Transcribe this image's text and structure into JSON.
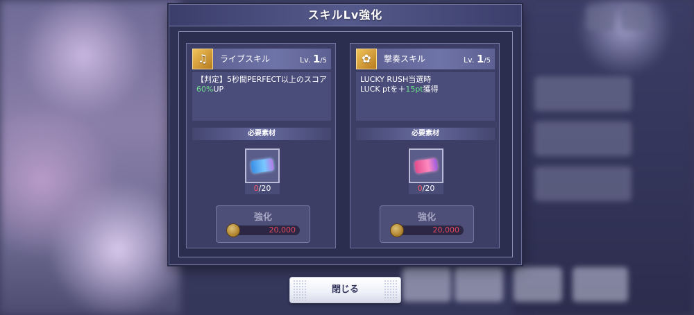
{
  "dialog": {
    "title": "スキルLv強化"
  },
  "cards": [
    {
      "skill_name": "ライブスキル",
      "level_prefix": "Lv.",
      "level": "1",
      "level_max": "/5",
      "icon": "music-note-icon",
      "desc_line1": "【判定】5秒間PERFECT以上のスコア",
      "desc_line2_green": "60%",
      "desc_line2_rest": "UP",
      "required_label": "必要素材",
      "item_have": "0",
      "item_need": "/20",
      "item_color": "#5aa8f2",
      "enhance_label": "強化",
      "cost": "20,000"
    },
    {
      "skill_name": "撃奏スキル",
      "level_prefix": "Lv.",
      "level": "1",
      "level_max": "/5",
      "icon": "flower-icon",
      "desc_line1": "LUCKY RUSH当選時",
      "desc_line2_prefix": "LUCK ptを＋",
      "desc_line2_green": "15pt",
      "desc_line2_rest": "獲得",
      "required_label": "必要素材",
      "item_have": "0",
      "item_need": "/20",
      "item_color": "#ff7ab8",
      "enhance_label": "強化",
      "cost": "20,000"
    }
  ],
  "close_button": {
    "label": "閉じる"
  },
  "colors": {
    "accent_green": "#6fe08a",
    "insufficient_red": "#ff5a6a",
    "cost_red": "#ff4a5e",
    "dialog_bg": "#2f3155"
  }
}
